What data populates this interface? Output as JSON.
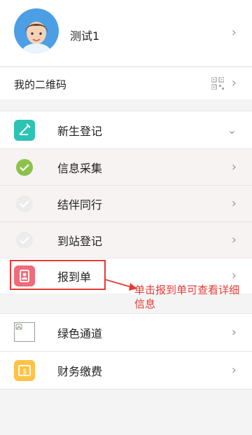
{
  "profile": {
    "name": "测试1"
  },
  "qr_row": {
    "label": "我的二维码"
  },
  "menu": {
    "header": {
      "label": "新生登记"
    },
    "steps": [
      {
        "label": "信息采集"
      },
      {
        "label": "结伴同行"
      },
      {
        "label": "到站登记"
      },
      {
        "label": "报到单"
      }
    ],
    "annotation": "单击报到单可查看详细信息"
  },
  "extras": [
    {
      "label": "绿色通道"
    },
    {
      "label": "财务缴费"
    }
  ],
  "colors": {
    "teal": "#2bc4b4",
    "green": "#8bc34a",
    "pink": "#f06b7a",
    "orange": "#ffc247",
    "annotation_red": "#e53935"
  },
  "icons": {
    "chevron": "chevron-right-icon",
    "qr": "qr-code-icon"
  }
}
